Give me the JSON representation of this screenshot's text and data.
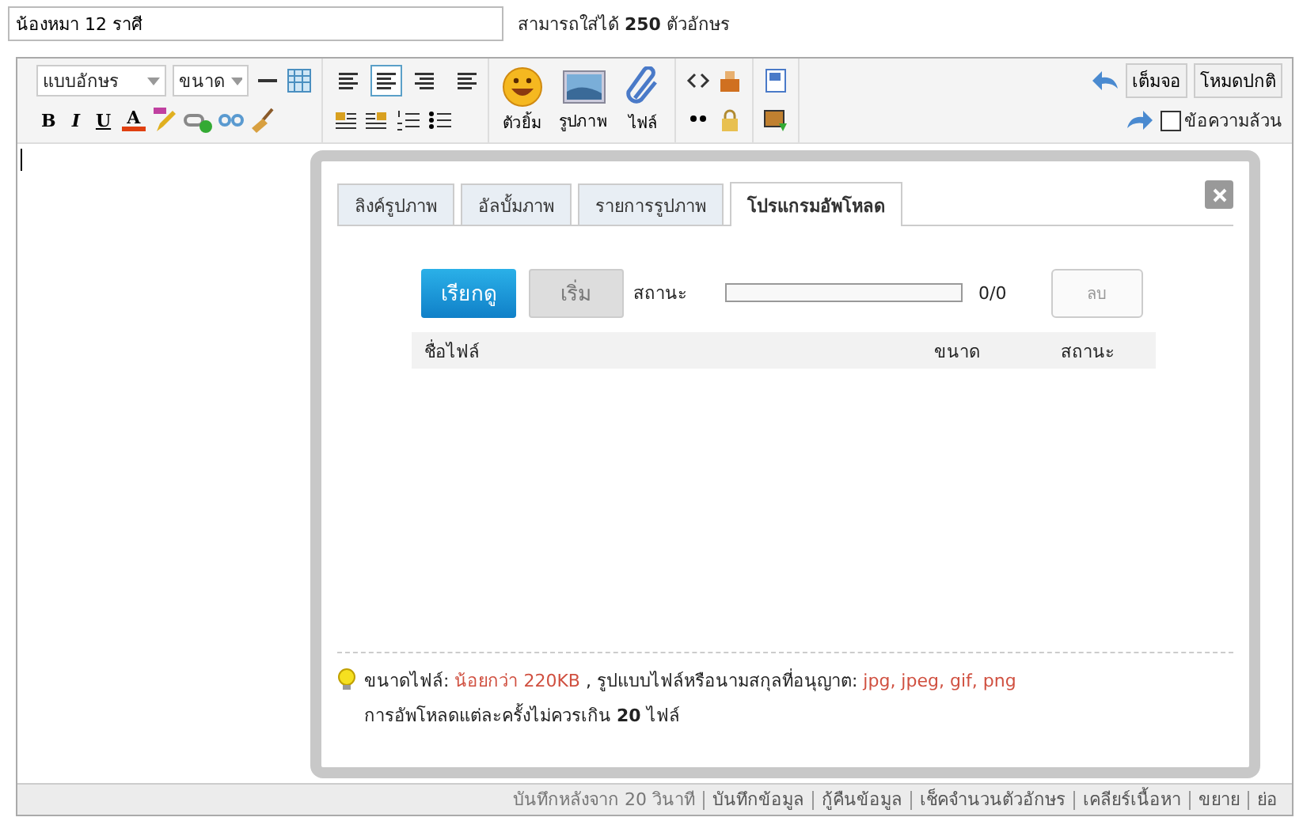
{
  "title_field": {
    "value": "น้องหมา 12 ราศี"
  },
  "char_limit": "สามารถใส่ได้ **250** ตัวอักษร",
  "toolbar": {
    "font_select": "แบบอักษร",
    "size_select": "ขนาด",
    "format_buttons": [
      "B",
      "I",
      "U",
      "A"
    ],
    "align_buttons": [
      {
        "selected": false
      },
      {
        "selected": true
      },
      {
        "selected": false
      },
      {
        "selected": false
      }
    ],
    "insert_buttons": [
      {
        "label": "ตัวยิ้ม",
        "kind": "smiley"
      },
      {
        "label": "รูปภาพ",
        "kind": "image"
      },
      {
        "label": "ไฟล์",
        "kind": "clip"
      }
    ],
    "fullscreen_button": "เต็มจอ",
    "normal_mode_button": "โหมดปกติ",
    "plain_text": {
      "label": "ข้อความล้วน",
      "checked": false
    }
  },
  "dialog": {
    "tabs": [
      {
        "label": "ลิงค์รูปภาพ",
        "selected": false
      },
      {
        "label": "อัลบั้มภาพ",
        "selected": false
      },
      {
        "label": "รายการรูปภาพ",
        "selected": false
      },
      {
        "label": "โปรแกรมอัพโหลด",
        "selected": true
      }
    ],
    "browse_button": "เรียกดู",
    "start_button": {
      "label": "เริ่ม",
      "disabled": true
    },
    "status_label": "สถานะ",
    "progress": {
      "level": 0
    },
    "count": "0/0",
    "delete_button": {
      "label": "ลบ",
      "disabled": true
    },
    "columns": [
      "ชื่อไฟล์",
      "ขนาด",
      "สถานะ"
    ],
    "note_segments": [
      {
        "text": "ขนาดไฟล์: ",
        "kind": "plain"
      },
      {
        "text": "น้อยกว่า 220KB",
        "kind": "value"
      },
      {
        "text": " , รูปแบบไฟล์หรือนามสกุลที่อนุญาต: ",
        "kind": "plain"
      },
      {
        "text": "jpg, jpeg, gif, png",
        "kind": "value"
      }
    ],
    "note_limit": "การอัพโหลดแต่ละครั้งไม่ควรเกิน **20** ไฟล์"
  },
  "status_bar": [
    {
      "label": "บันทึกหลังจาก 20 วินาที",
      "kind": "text"
    },
    {
      "label": "บันทึกข้อมูล",
      "kind": "link"
    },
    {
      "label": "กู้คืนข้อมูล",
      "kind": "link"
    },
    {
      "label": "เช็คจำนวนตัวอักษร",
      "kind": "link"
    },
    {
      "label": "เคลียร์เนื้อหา",
      "kind": "link"
    },
    {
      "label": "ขยาย",
      "kind": "link"
    },
    {
      "label": "ย่อ",
      "kind": "link"
    }
  ]
}
